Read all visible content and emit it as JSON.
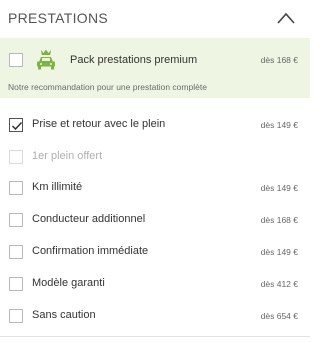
{
  "header": {
    "title": "PRESTATIONS",
    "collapse_icon": "chevron-up-icon"
  },
  "premium": {
    "label": "Pack prestations premium",
    "price": "dès 168 €",
    "note": "Notre recommandation pour une prestation complète",
    "icon": "car-crown-icon",
    "checked": false,
    "accent": "#7cb342",
    "background": "#eef5e3"
  },
  "options": [
    {
      "label": "Prise et retour avec le plein",
      "price": "dès 149 €",
      "checked": true,
      "disabled": false
    },
    {
      "label": "1er plein offert",
      "price": "",
      "checked": false,
      "disabled": true
    },
    {
      "label": "Km illimité",
      "price": "dès 149 €",
      "checked": false,
      "disabled": false
    },
    {
      "label": "Conducteur additionnel",
      "price": "dès 168 €",
      "checked": false,
      "disabled": false
    },
    {
      "label": "Confirmation immédiate",
      "price": "dès 149 €",
      "checked": false,
      "disabled": false
    },
    {
      "label": "Modèle garanti",
      "price": "dès 412 €",
      "checked": false,
      "disabled": false
    },
    {
      "label": "Sans caution",
      "price": "dès 654 €",
      "checked": false,
      "disabled": false
    }
  ]
}
